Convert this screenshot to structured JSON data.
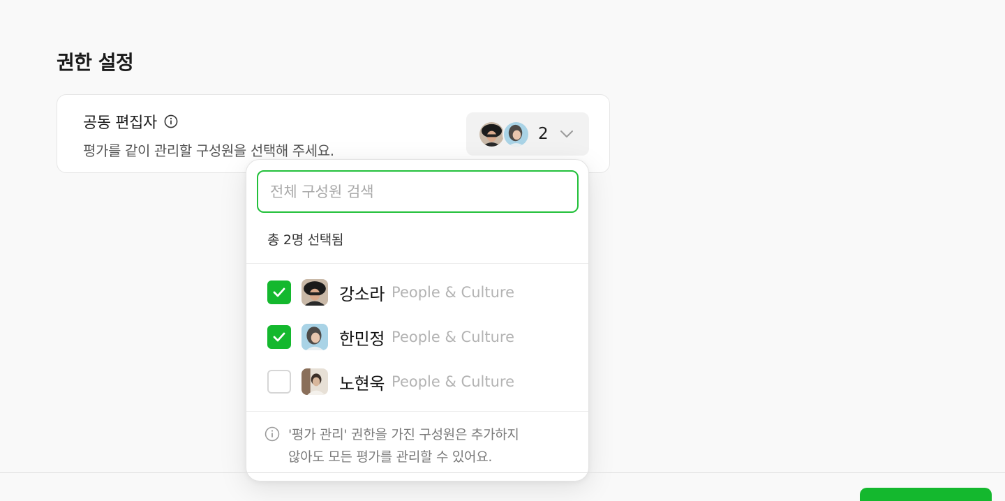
{
  "section": {
    "title": "권한 설정"
  },
  "co_editor": {
    "title": "공동 편집자",
    "description": "평가를 같이 관리할 구성원을 선택해 주세요.",
    "selected_count": "2"
  },
  "dropdown": {
    "search_placeholder": "전체 구성원 검색",
    "selected_summary": "총 2명 선택됨",
    "members": [
      {
        "name": "강소라",
        "team": "People & Culture",
        "checked": true
      },
      {
        "name": "한민정",
        "team": "People & Culture",
        "checked": true
      },
      {
        "name": "노현욱",
        "team": "People & Culture",
        "checked": false
      }
    ],
    "notice_line1": "'평가 관리' 권한을 가진 구성원은 추가하지",
    "notice_line2": "않아도 모든 평가를 관리할 수 있어요."
  },
  "colors": {
    "accent": "#14b82e",
    "search_border": "#22c03a",
    "muted_text": "#b3b3b3"
  },
  "icons": [
    "info-icon",
    "chevron-down-icon",
    "check-icon"
  ]
}
